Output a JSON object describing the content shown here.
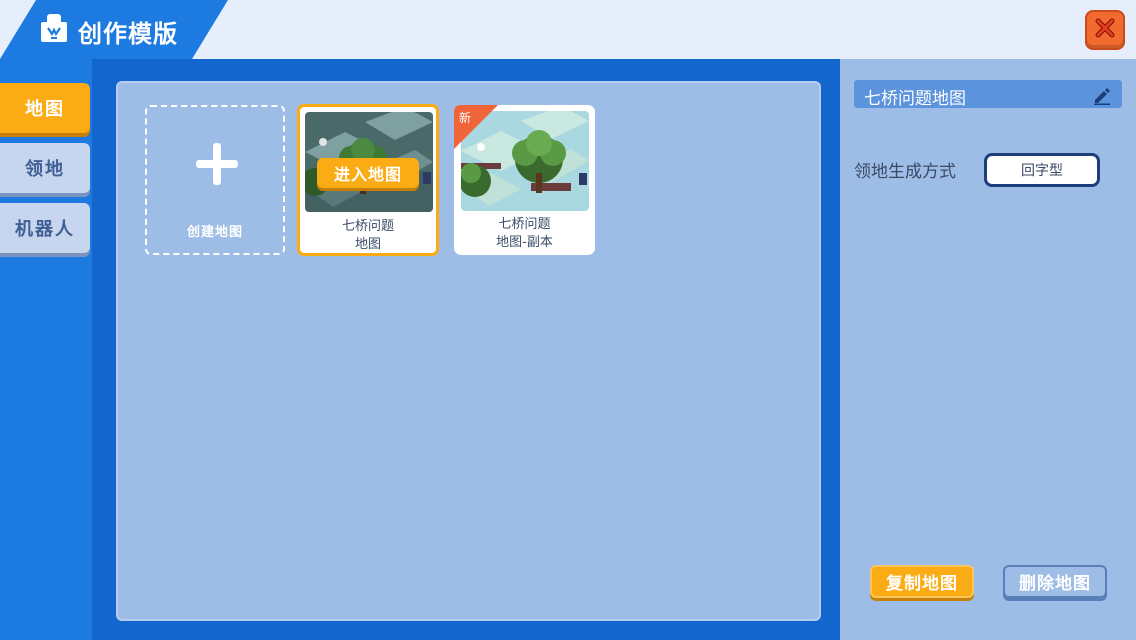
{
  "window": {
    "title": "创作模版",
    "title_icon": "lightbulb-icon",
    "close_icon": "close-icon"
  },
  "nav": {
    "tabs": [
      {
        "label": "地图",
        "active": true
      },
      {
        "label": "领地",
        "active": false
      },
      {
        "label": "机器人",
        "active": false
      }
    ]
  },
  "main": {
    "create_label": "创建地图",
    "maps": [
      {
        "name_line1": "七桥问题",
        "name_line2": "地图",
        "selected": true,
        "action_label": "进入地图"
      },
      {
        "name_line1": "七桥问题",
        "name_line2": "地图-副本",
        "selected": false,
        "badge": "新"
      }
    ]
  },
  "details": {
    "map_name": "七桥问题地图",
    "generation_label": "领地生成方式",
    "generation_value": "回字型",
    "copy_label": "复制地图",
    "delete_label": "删除地图"
  },
  "colors": {
    "accent_orange": "#fbab14",
    "primary_blue": "#1c7ae0",
    "panel_blue": "#9ebde6",
    "close_red": "#f26a2e"
  }
}
